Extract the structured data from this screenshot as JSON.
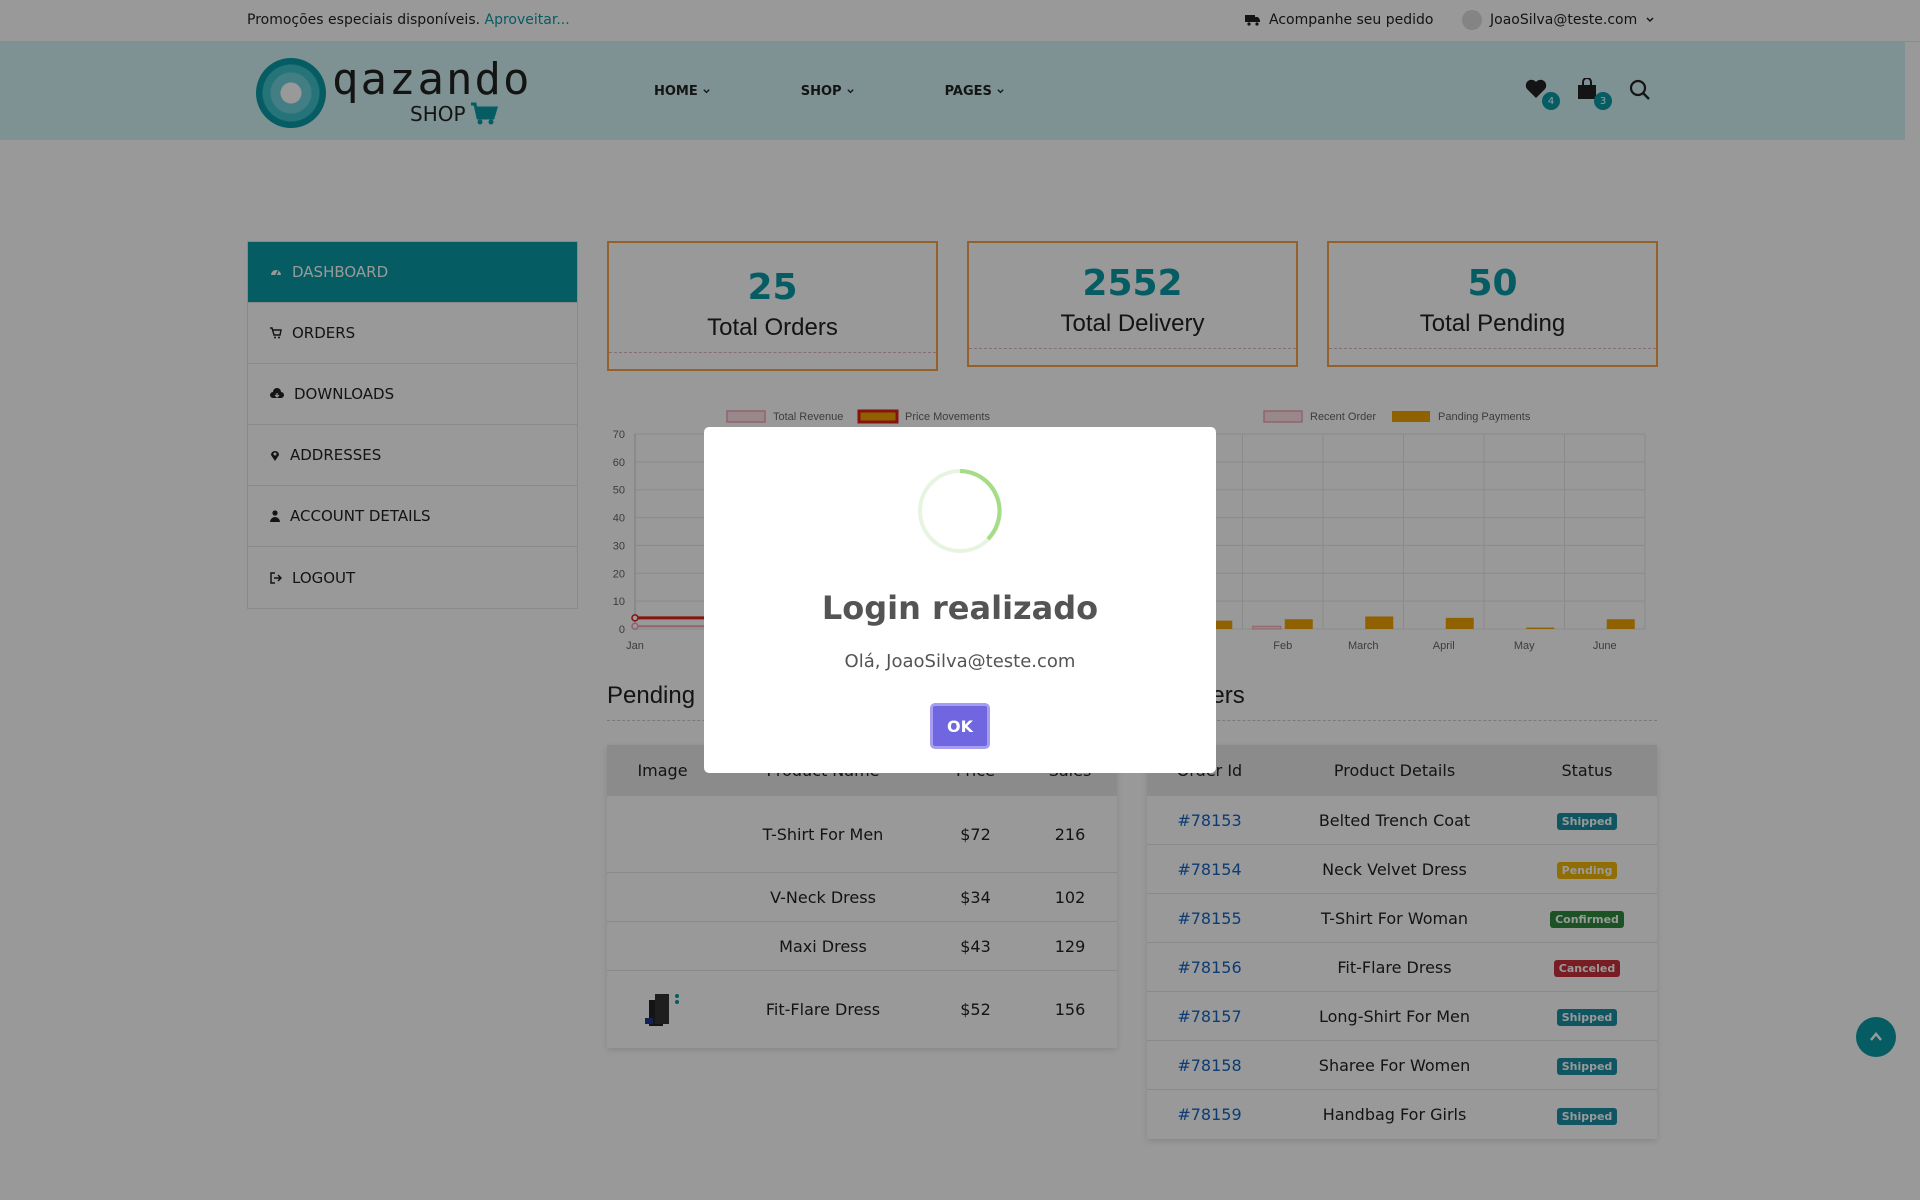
{
  "topbar": {
    "promo_text": "Promoções especiais disponíveis.",
    "promo_link": "Aproveitar...",
    "track_text": "Acompanhe seu pedido",
    "user_email": "JoaoSilva@teste.com"
  },
  "header": {
    "logo_text": "qazando",
    "logo_sub": "SHOP",
    "nav": [
      "HOME",
      "SHOP",
      "PAGES"
    ],
    "wishlist_count": "4",
    "cart_count": "3"
  },
  "sidebar": {
    "items": [
      {
        "label": "DASHBOARD",
        "icon": "dashboard-icon",
        "active": true
      },
      {
        "label": "ORDERS",
        "icon": "cart-icon"
      },
      {
        "label": "DOWNLOADS",
        "icon": "cloud-download-icon"
      },
      {
        "label": "ADDRESSES",
        "icon": "map-pin-icon"
      },
      {
        "label": "ACCOUNT DETAILS",
        "icon": "user-icon"
      },
      {
        "label": "LOGOUT",
        "icon": "logout-icon"
      }
    ]
  },
  "stats": [
    {
      "value": "25",
      "label": "Total Orders"
    },
    {
      "value": "2552",
      "label": "Total Delivery"
    },
    {
      "value": "50",
      "label": "Total Pending"
    }
  ],
  "colors": {
    "accent": "#0a9aa6",
    "card_border": "#f3a24a",
    "ok_button": "#7066e0",
    "shipped": "#1a8fa3",
    "pending": "#f2b705",
    "confirmed": "#2e8b3d",
    "canceled": "#c8313b"
  },
  "chart_data": [
    {
      "type": "line",
      "categories": [
        "Jan",
        "Feb",
        "March",
        "April",
        "May",
        "June"
      ],
      "series": [
        {
          "name": "Total Revenue",
          "values": [
            1,
            1,
            1,
            1,
            1,
            1
          ]
        },
        {
          "name": "Price Movements",
          "values": [
            4,
            4,
            4,
            4,
            4,
            4
          ]
        }
      ],
      "legend": "top",
      "ylim": [
        0,
        70
      ],
      "yticks": [
        0,
        10,
        20,
        30,
        40,
        50,
        60,
        70
      ]
    },
    {
      "type": "bar",
      "categories": [
        "Jan",
        "Feb",
        "March",
        "April",
        "May",
        "June"
      ],
      "series": [
        {
          "name": "Recent Order",
          "values": [
            0,
            1,
            0,
            0,
            0,
            0
          ]
        },
        {
          "name": "Panding Payments",
          "values": [
            3,
            3.5,
            4.5,
            4,
            0.5,
            3.5
          ]
        }
      ],
      "legend": "top"
    }
  ],
  "pending": {
    "title": "Pending",
    "headers": [
      "Image",
      "Product Name",
      "Price",
      "Sales"
    ],
    "rows": [
      {
        "name": "T-Shirt For Men",
        "price": "$72",
        "sales": "216"
      },
      {
        "name": "V-Neck Dress",
        "price": "$34",
        "sales": "102"
      },
      {
        "name": "Maxi Dress",
        "price": "$43",
        "sales": "129"
      },
      {
        "name": "Fit-Flare Dress",
        "price": "$52",
        "sales": "156"
      }
    ]
  },
  "recent": {
    "title": "ders",
    "headers": [
      "Order Id",
      "Product Details",
      "Status"
    ],
    "rows": [
      {
        "id": "#78153",
        "product": "Belted Trench Coat",
        "status": "Shipped",
        "color": "#1a8fa3"
      },
      {
        "id": "#78154",
        "product": "Neck Velvet Dress",
        "status": "Pending",
        "color": "#f2b705"
      },
      {
        "id": "#78155",
        "product": "T-Shirt For Woman",
        "status": "Confirmed",
        "color": "#2e8b3d"
      },
      {
        "id": "#78156",
        "product": "Fit-Flare Dress",
        "status": "Canceled",
        "color": "#c8313b"
      },
      {
        "id": "#78157",
        "product": "Long-Shirt For Men",
        "status": "Shipped",
        "color": "#1a8fa3"
      },
      {
        "id": "#78158",
        "product": "Sharee For Women",
        "status": "Shipped",
        "color": "#1a8fa3"
      },
      {
        "id": "#78159",
        "product": "Handbag For Girls",
        "status": "Shipped",
        "color": "#1a8fa3"
      }
    ]
  },
  "modal": {
    "title": "Login realizado",
    "message": "Olá, JoaoSilva@teste.com",
    "ok_label": "OK"
  }
}
